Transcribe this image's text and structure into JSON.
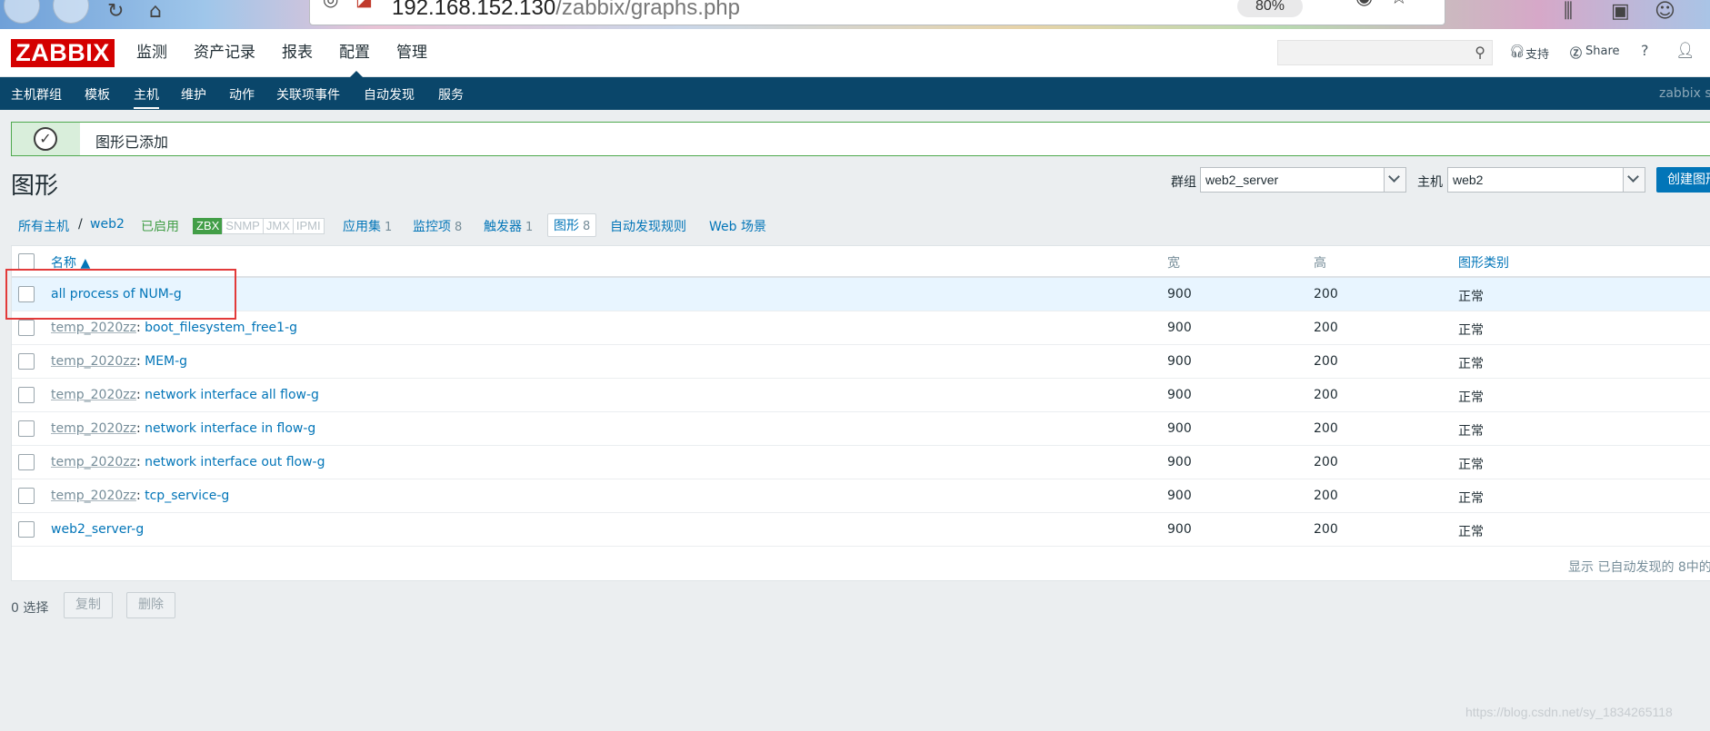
{
  "browser": {
    "url_host": "192.168.152.130",
    "url_path": "/zabbix/graphs.php",
    "zoom": "80%"
  },
  "header": {
    "logo": "ZABBIX",
    "menu": [
      "监测",
      "资产记录",
      "报表",
      "配置",
      "管理"
    ],
    "active_menu": "配置",
    "support_label": "支持",
    "share_label": "Share",
    "help_label": "?"
  },
  "subnav": {
    "items": [
      "主机群组",
      "模板",
      "主机",
      "维护",
      "动作",
      "关联项事件",
      "自动发现",
      "服务"
    ],
    "active": "主机",
    "server_name": "zabbix se"
  },
  "message": {
    "text": "图形已添加"
  },
  "page": {
    "title": "图形",
    "group_label": "群组",
    "group_value": "web2_server",
    "host_label": "主机",
    "host_value": "web2",
    "create_button": "创建图形"
  },
  "host_nav": {
    "all_hosts": "所有主机",
    "separator": "/",
    "host": "web2",
    "status": "已启用",
    "availability": [
      "ZBX",
      "SNMP",
      "JMX",
      "IPMI"
    ],
    "applications": {
      "label": "应用集",
      "count": "1"
    },
    "items": {
      "label": "监控项",
      "count": "8"
    },
    "triggers": {
      "label": "触发器",
      "count": "1"
    },
    "graphs": {
      "label": "图形",
      "count": "8"
    },
    "discovery": "自动发现规则",
    "web": "Web 场景"
  },
  "table": {
    "headers": {
      "name": "名称 ▲",
      "width": "宽",
      "height": "高",
      "graph_type": "图形类别"
    },
    "rows": [
      {
        "prefix": "",
        "name": "all process of NUM-g",
        "width": "900",
        "height": "200",
        "type": "正常"
      },
      {
        "prefix": "temp_2020zz",
        "name": "boot_filesystem_free1-g",
        "width": "900",
        "height": "200",
        "type": "正常"
      },
      {
        "prefix": "temp_2020zz",
        "name": "MEM-g",
        "width": "900",
        "height": "200",
        "type": "正常"
      },
      {
        "prefix": "temp_2020zz",
        "name": "network interface all flow-g",
        "width": "900",
        "height": "200",
        "type": "正常"
      },
      {
        "prefix": "temp_2020zz",
        "name": "network interface in flow-g",
        "width": "900",
        "height": "200",
        "type": "正常"
      },
      {
        "prefix": "temp_2020zz",
        "name": "network interface out flow-g",
        "width": "900",
        "height": "200",
        "type": "正常"
      },
      {
        "prefix": "temp_2020zz",
        "name": "tcp_service-g",
        "width": "900",
        "height": "200",
        "type": "正常"
      },
      {
        "prefix": "",
        "name": "web2_server-g",
        "width": "900",
        "height": "200",
        "type": "正常"
      }
    ],
    "footer": "显示 已自动发现的 8中的"
  },
  "actions": {
    "selected": "0 选择",
    "copy": "复制",
    "delete": "删除"
  },
  "watermark": "https://blog.csdn.net/sy_1834265118"
}
